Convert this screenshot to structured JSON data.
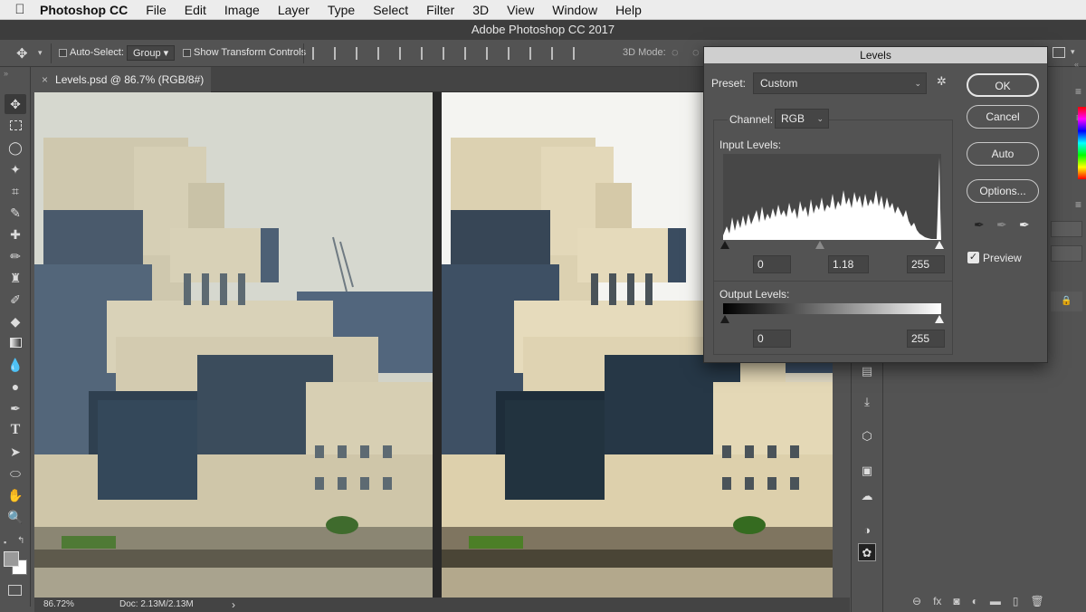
{
  "menubar": {
    "app": "Photoshop CC",
    "items": [
      "File",
      "Edit",
      "Image",
      "Layer",
      "Type",
      "Select",
      "Filter",
      "3D",
      "View",
      "Window",
      "Help"
    ]
  },
  "window": {
    "title": "Adobe Photoshop CC 2017"
  },
  "options": {
    "auto_select_label": "Auto-Select:",
    "auto_select_value": "Group",
    "transform_label": "Show Transform Controls",
    "mode3d_label": "3D Mode:"
  },
  "document": {
    "tab_title": "Levels.psd @ 86.7% (RGB/8#) *",
    "close_glyph": "×"
  },
  "status": {
    "zoom": "86.72%",
    "doc": "Doc: 2.13M/2.13M",
    "arrow": "›"
  },
  "levels": {
    "title": "Levels",
    "preset_label": "Preset:",
    "preset_value": "Custom",
    "channel_label": "Channel:",
    "channel_value": "RGB",
    "input_label": "Input Levels:",
    "input_black": "0",
    "input_gamma": "1.18",
    "input_white": "255",
    "output_label": "Output Levels:",
    "output_black": "0",
    "output_white": "255",
    "ok_label": "OK",
    "cancel_label": "Cancel",
    "auto_label": "Auto",
    "options_label": "Options...",
    "preview_label": "Preview",
    "preview_checked": true
  },
  "colors": {
    "ui_bg": "#535353",
    "dialog_title": "#cfcfcf",
    "canvas": "#282828"
  }
}
